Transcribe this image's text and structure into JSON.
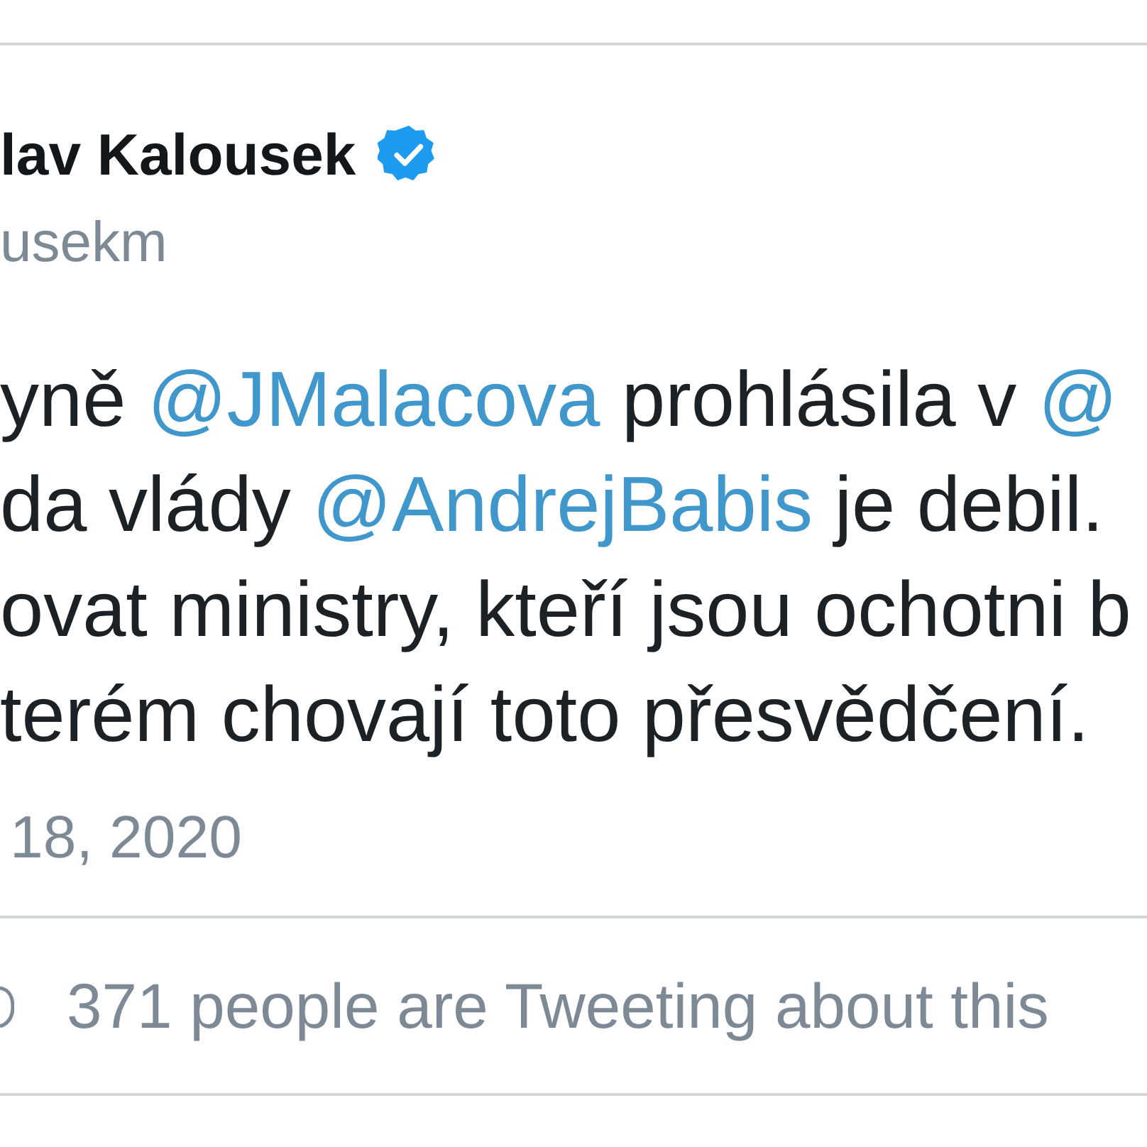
{
  "tweet": {
    "author": {
      "name": "lav Kalousek",
      "verified": true,
      "handle": "usekm"
    },
    "text_lines": [
      [
        {
          "kind": "text",
          "text": "yně "
        },
        {
          "kind": "mention",
          "text": "@JMalacova"
        },
        {
          "kind": "text",
          "text": " prohlásila v "
        },
        {
          "kind": "mention",
          "text": "@"
        }
      ],
      [
        {
          "kind": "text",
          "text": "da vlády "
        },
        {
          "kind": "mention",
          "text": "@AndrejBabis"
        },
        {
          "kind": "text",
          "text": " je debil."
        }
      ],
      [
        {
          "kind": "text",
          "text": "ovat ministry, kteří jsou ochotni b"
        }
      ],
      [
        {
          "kind": "text",
          "text": "terém chovají toto přesvědčení."
        }
      ]
    ],
    "date": "18, 2020"
  },
  "footer": {
    "text": "371 people are Tweeting about this"
  }
}
